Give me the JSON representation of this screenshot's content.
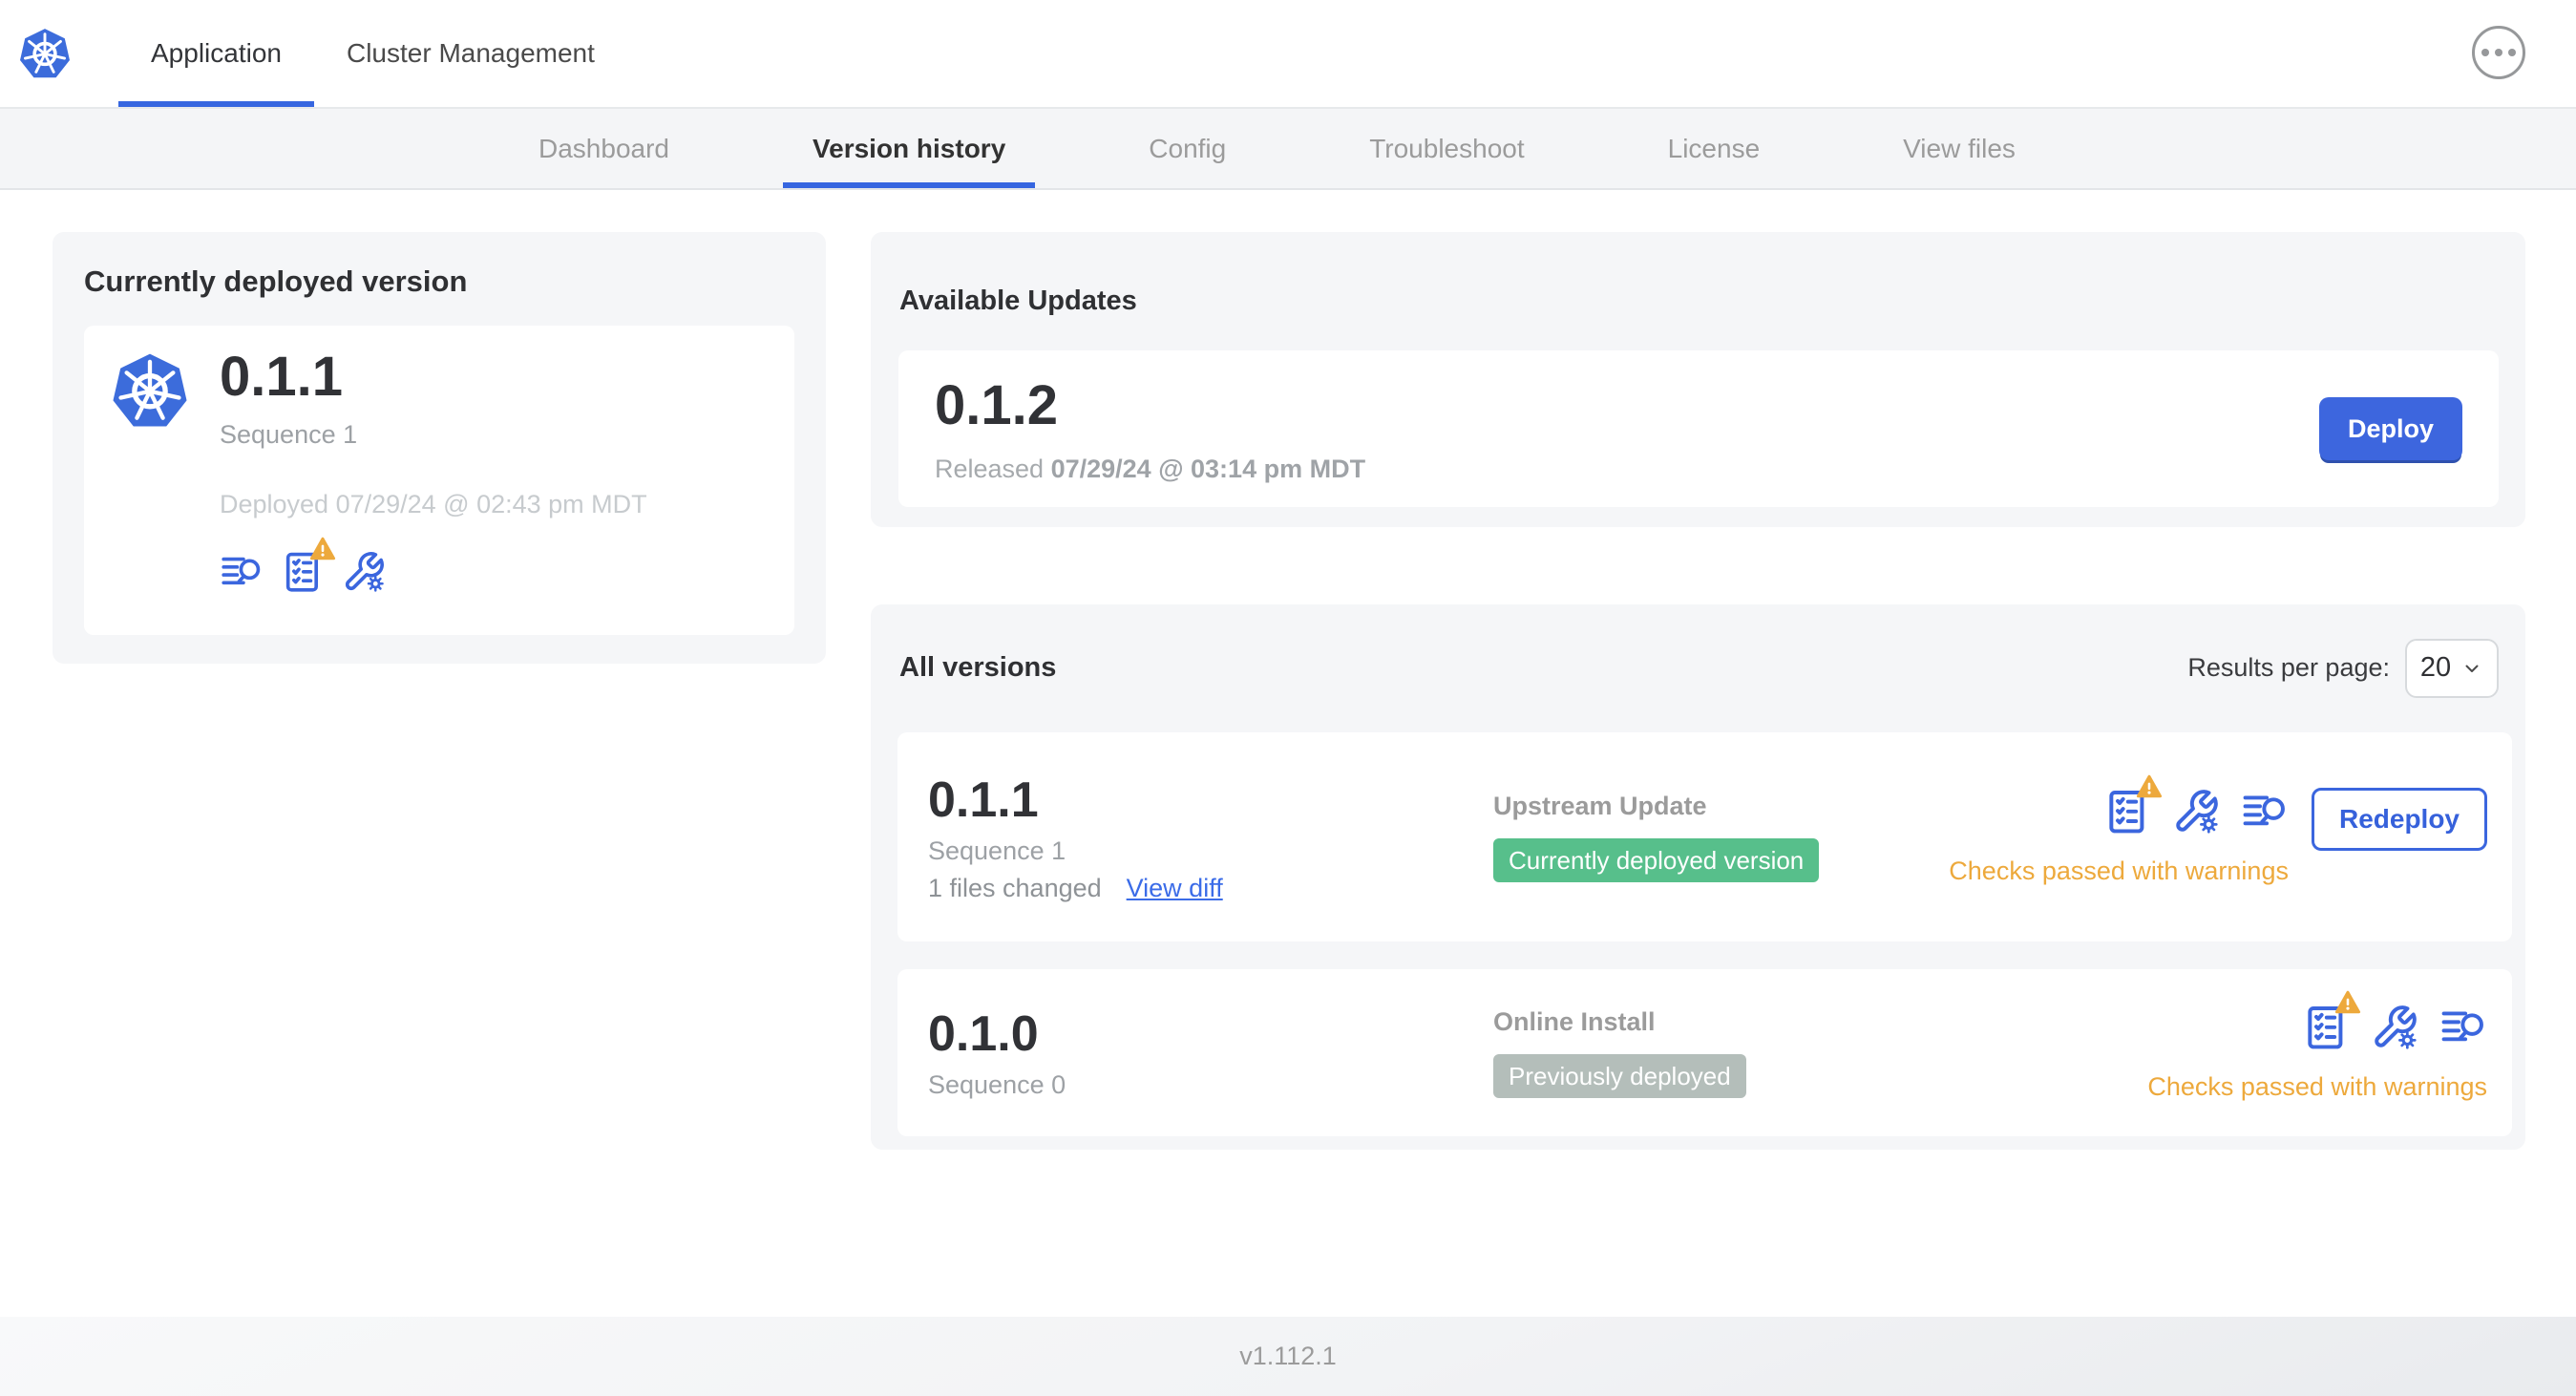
{
  "header": {
    "tabs": [
      {
        "label": "Application",
        "active": true
      },
      {
        "label": "Cluster Management",
        "active": false
      }
    ]
  },
  "subnav": {
    "tabs": [
      "Dashboard",
      "Version history",
      "Config",
      "Troubleshoot",
      "License",
      "View files"
    ],
    "active": "Version history"
  },
  "deployed": {
    "title": "Currently deployed version",
    "version": "0.1.1",
    "sequence": "Sequence 1",
    "deployed_at": "Deployed 07/29/24 @ 02:43 pm MDT"
  },
  "updates": {
    "title": "Available Updates",
    "version": "0.1.2",
    "released_prefix": "Released",
    "released_date": "07/29/24 @ 03:14 pm MDT",
    "deploy_label": "Deploy"
  },
  "versions": {
    "title": "All versions",
    "results_per_page_label": "Results per page:",
    "results_per_page_value": "20",
    "rows": [
      {
        "version": "0.1.1",
        "sequence": "Sequence 1",
        "files_changed": "1 files changed",
        "view_diff": "View diff",
        "source": "Upstream Update",
        "badge": "Currently deployed version",
        "badge_type": "green",
        "status": "Checks passed with warnings",
        "action": "Redeploy"
      },
      {
        "version": "0.1.0",
        "sequence": "Sequence 0",
        "source": "Online Install",
        "badge": "Previously deployed",
        "badge_type": "gray",
        "status": "Checks passed with warnings"
      }
    ]
  },
  "footer": {
    "app_version": "v1.112.1"
  },
  "icons": {
    "logo": "kubernetes-logo",
    "more": "ellipsis-icon",
    "logs": "view-logs-icon",
    "preflight": "preflight-checks-icon",
    "config": "wrench-config-icon",
    "warning": "warning-triangle-icon",
    "chevron": "chevron-down-icon"
  },
  "colors": {
    "accent": "#3B66DE",
    "logo_blue": "#3C6CDB",
    "warning": "#EDA93C",
    "success_badge": "#57BF8B",
    "neutral_badge": "#B4BEBA",
    "card_bg": "#F5F6F8"
  }
}
